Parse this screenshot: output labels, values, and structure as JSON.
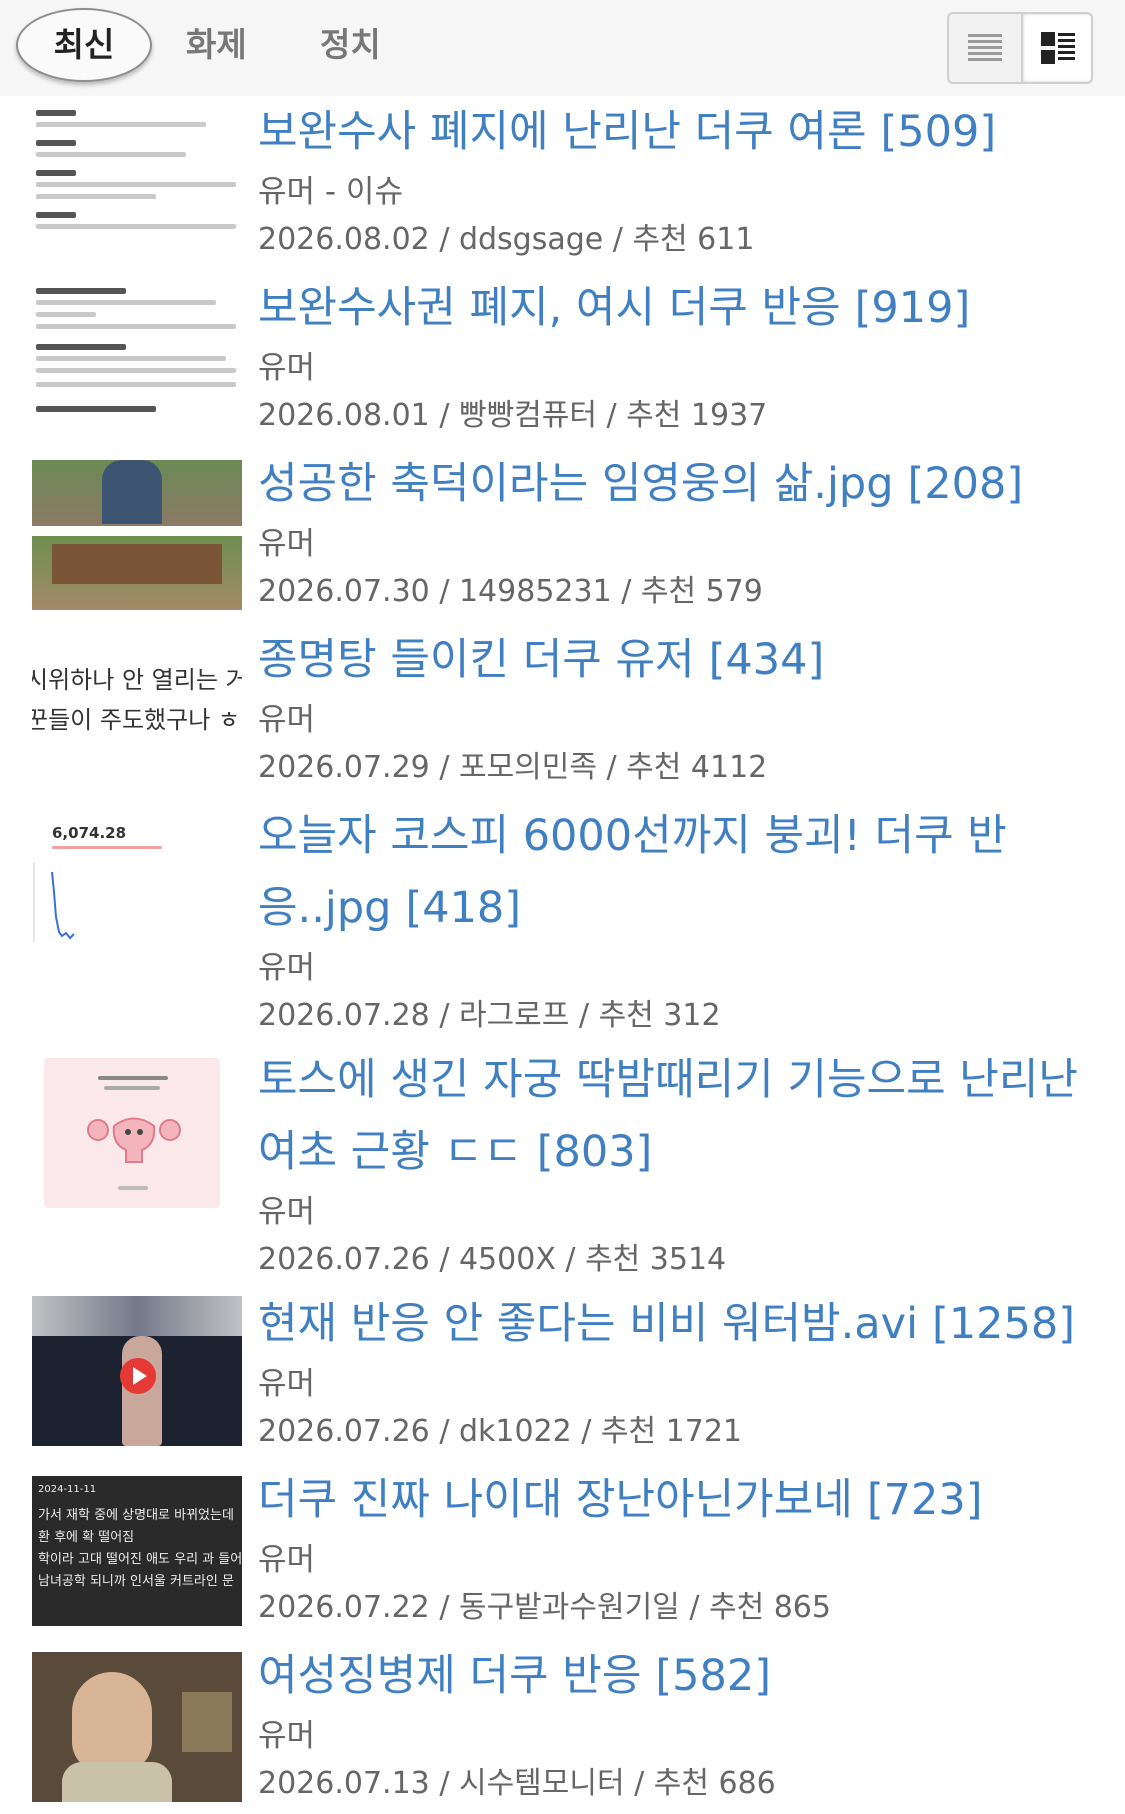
{
  "tabs": [
    {
      "label": "최신",
      "active": true
    },
    {
      "label": "화제",
      "active": false
    },
    {
      "label": "정치",
      "active": false
    }
  ],
  "view_toggle": {
    "list_icon": "list-view-icon",
    "thumb_icon": "thumbnail-view-icon",
    "selected": "thumbnail"
  },
  "posts": [
    {
      "title": "보완수사 폐지에 난리난 더쿠 여론",
      "comments": "[509]",
      "category": "유머 - 이슈",
      "date": "2026.08.02",
      "author": "ddsgsage",
      "recommend": "추천 611",
      "thumb": "doc-list"
    },
    {
      "title": "보완수사권 폐지, 여시 더쿠 반응",
      "comments": "[919]",
      "category": "유머",
      "date": "2026.08.01",
      "author": "빵빵컴퓨터",
      "recommend": "추천 1937",
      "thumb": "doc-list-2"
    },
    {
      "title": "성공한 축덕이라는 임영웅의 삶.jpg",
      "comments": "[208]",
      "category": "유머",
      "date": "2026.07.30",
      "author": "14985231",
      "recommend": "추천 579",
      "thumb": "photo-outdoor"
    },
    {
      "title": "종명탕 들이킨 더쿠 유저",
      "comments": "[434]",
      "category": "유머",
      "date": "2026.07.29",
      "author": "포모의민족",
      "recommend": "추천 4112",
      "thumb": "text-crop"
    },
    {
      "title": "오늘자 코스피 6000선까지 붕괴! 더쿠 반응..jpg",
      "comments": "[418]",
      "category": "유머",
      "date": "2026.07.28",
      "author": "라그로프",
      "recommend": "추천 312",
      "thumb": "stock-chart"
    },
    {
      "title": "토스에 생긴 자궁 딱밤때리기 기능으로 난리난 여초 근황 ㄷㄷ",
      "comments": "[803]",
      "category": "유머",
      "date": "2026.07.26",
      "author": "4500X",
      "recommend": "추천 3514",
      "thumb": "app-illustration"
    },
    {
      "title": "현재 반응 안 좋다는 비비 워터밤.avi",
      "comments": "[1258]",
      "category": "유머",
      "date": "2026.07.26",
      "author": "dk1022",
      "recommend": "추천 1721",
      "thumb": "video-stage"
    },
    {
      "title": "더쿠 진짜 나이대 장난아닌가보네",
      "comments": "[723]",
      "category": "유머",
      "date": "2026.07.22",
      "author": "동구밭과수원기일",
      "recommend": "추천 865",
      "thumb": "dark-post"
    },
    {
      "title": "여성징병제 더쿠 반응",
      "comments": "[582]",
      "category": "유머",
      "date": "2026.07.13",
      "author": "시수템모니터",
      "recommend": "추천 686",
      "thumb": "tv-screenshot"
    }
  ],
  "thumb_texts": {
    "text_crop_1": "시위하나 안 열리는 거",
    "text_crop_2": "꾼들이 주도했구나 ㅎ",
    "stock_value": "6,074.28",
    "dark_date": "2024-11-11",
    "dark_1": "가서 재학 중에 상명대로 바뀌었는데",
    "dark_2": "환 후에 확 떨어짐",
    "dark_3": "학이라 고대 떨어진 애도 우리 과 들어",
    "dark_4": "남녀공학 되니까 인서울 커트라인 문"
  },
  "colors": {
    "title_link": "#3f7fc2",
    "meta_text": "#666666",
    "header_bg": "#f6f6f6"
  }
}
